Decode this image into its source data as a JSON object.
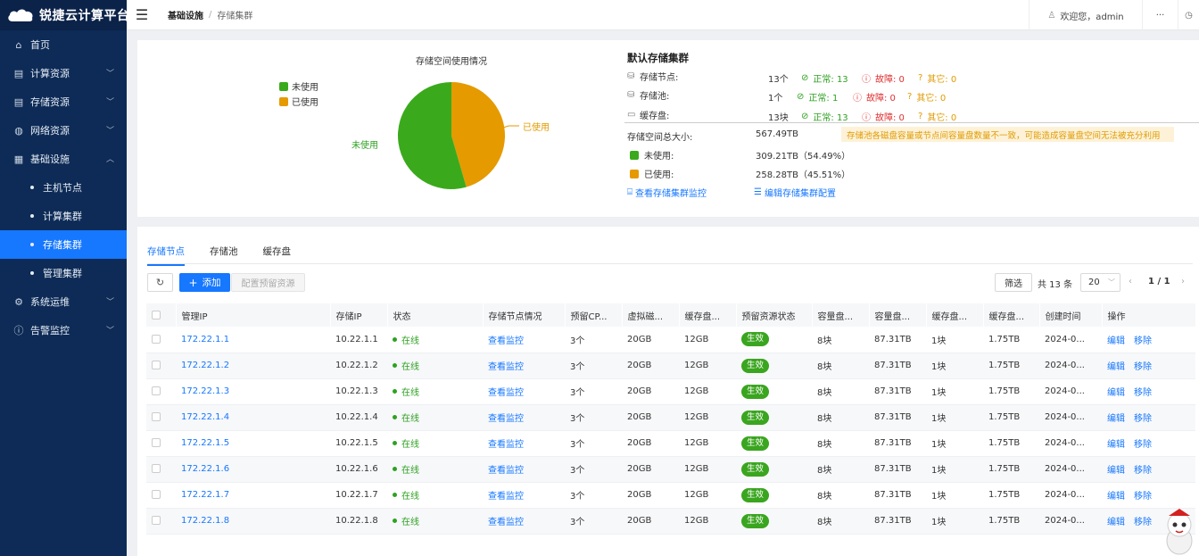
{
  "app": {
    "title": "锐捷云计算平台"
  },
  "sidebar": {
    "items": [
      {
        "label": "首页",
        "icon": "home-icon"
      },
      {
        "label": "计算资源",
        "icon": "server-icon"
      },
      {
        "label": "存储资源",
        "icon": "storage-icon"
      },
      {
        "label": "网络资源",
        "icon": "globe-icon"
      },
      {
        "label": "基础设施",
        "icon": "grid-icon"
      },
      {
        "label": "主机节点"
      },
      {
        "label": "计算集群"
      },
      {
        "label": "存储集群"
      },
      {
        "label": "管理集群"
      },
      {
        "label": "系统运维",
        "icon": "gear-icon"
      },
      {
        "label": "告警监控",
        "icon": "alert-icon"
      }
    ],
    "active": "存储集群"
  },
  "header": {
    "breadcrumb": [
      "基础设施",
      "存储集群"
    ],
    "separator": "/",
    "welcome": "欢迎您，admin",
    "more": "···"
  },
  "usage": {
    "title": "存储空间使用情况",
    "legend": [
      "未使用",
      "已使用"
    ],
    "label_unused": "未使用",
    "label_used": "已使用",
    "colors": {
      "unused": "#3aaa1c",
      "used": "#e59a00"
    }
  },
  "chart_data": {
    "type": "pie",
    "title": "存储空间使用情况",
    "categories": [
      "未使用",
      "已使用"
    ],
    "values": [
      54.49,
      45.51
    ],
    "units": "%",
    "legend_position": "top-left"
  },
  "cluster": {
    "title": "默认存储集群",
    "rows": [
      {
        "label": "存储节点:",
        "count": "13个",
        "normal": "正常: 13",
        "fault": "故障: 0",
        "other": "其它: 0"
      },
      {
        "label": "存储池:",
        "count": "1个",
        "normal": "正常: 1",
        "fault": "故障: 0",
        "other": "其它: 0"
      },
      {
        "label": "缓存盘:",
        "count": "13块",
        "normal": "正常: 13",
        "fault": "故障: 0",
        "other": "其它: 0"
      }
    ],
    "total_label": "存储空间总大小:",
    "total_value": "567.49TB",
    "warning": "存储池各磁盘容量或节点间容量盘数量不一致，可能造成容量盘空间无法被充分利用",
    "unused_label": "未使用:",
    "unused_value": "309.21TB（54.49%）",
    "used_label": "已使用:",
    "used_value": "258.28TB（45.51%）",
    "link_monitor": "查看存储集群监控",
    "link_config": "编辑存储集群配置"
  },
  "tabs": [
    "存储节点",
    "存储池",
    "缓存盘"
  ],
  "toolbar": {
    "refresh": "↻",
    "add": "添加",
    "reserve": "配置预留资源"
  },
  "pagination": {
    "filter": "筛选",
    "total": "共 13 条",
    "page_size": "20",
    "page": "1 / 1",
    "prev": "‹",
    "next": "›"
  },
  "table": {
    "columns": [
      "管理IP",
      "存储IP",
      "状态",
      "存储节点情况",
      "预留CP...",
      "虚拟磁...",
      "缓存盘...",
      "预留资源状态",
      "容量盘...",
      "容量盘...",
      "缓存盘...",
      "缓存盘...",
      "创建时间",
      "操作"
    ],
    "rows": [
      {
        "mgmt_ip": "172.22.1.1",
        "storage_ip": "10.22.1.1",
        "status": "在线",
        "monitor": "查看监控",
        "cpu": "3个",
        "vdisk": "20GB",
        "cache": "12GB",
        "res_status": "生效",
        "cap_count": "8块",
        "cap_size": "87.31TB",
        "cache_count": "1块",
        "cache_size": "1.75TB",
        "created": "2024-0...",
        "edit": "编辑",
        "remove": "移除"
      },
      {
        "mgmt_ip": "172.22.1.2",
        "storage_ip": "10.22.1.2",
        "status": "在线",
        "monitor": "查看监控",
        "cpu": "3个",
        "vdisk": "20GB",
        "cache": "12GB",
        "res_status": "生效",
        "cap_count": "8块",
        "cap_size": "87.31TB",
        "cache_count": "1块",
        "cache_size": "1.75TB",
        "created": "2024-0...",
        "edit": "编辑",
        "remove": "移除"
      },
      {
        "mgmt_ip": "172.22.1.3",
        "storage_ip": "10.22.1.3",
        "status": "在线",
        "monitor": "查看监控",
        "cpu": "3个",
        "vdisk": "20GB",
        "cache": "12GB",
        "res_status": "生效",
        "cap_count": "8块",
        "cap_size": "87.31TB",
        "cache_count": "1块",
        "cache_size": "1.75TB",
        "created": "2024-0...",
        "edit": "编辑",
        "remove": "移除"
      },
      {
        "mgmt_ip": "172.22.1.4",
        "storage_ip": "10.22.1.4",
        "status": "在线",
        "monitor": "查看监控",
        "cpu": "3个",
        "vdisk": "20GB",
        "cache": "12GB",
        "res_status": "生效",
        "cap_count": "8块",
        "cap_size": "87.31TB",
        "cache_count": "1块",
        "cache_size": "1.75TB",
        "created": "2024-0...",
        "edit": "编辑",
        "remove": "移除"
      },
      {
        "mgmt_ip": "172.22.1.5",
        "storage_ip": "10.22.1.5",
        "status": "在线",
        "monitor": "查看监控",
        "cpu": "3个",
        "vdisk": "20GB",
        "cache": "12GB",
        "res_status": "生效",
        "cap_count": "8块",
        "cap_size": "87.31TB",
        "cache_count": "1块",
        "cache_size": "1.75TB",
        "created": "2024-0...",
        "edit": "编辑",
        "remove": "移除"
      },
      {
        "mgmt_ip": "172.22.1.6",
        "storage_ip": "10.22.1.6",
        "status": "在线",
        "monitor": "查看监控",
        "cpu": "3个",
        "vdisk": "20GB",
        "cache": "12GB",
        "res_status": "生效",
        "cap_count": "8块",
        "cap_size": "87.31TB",
        "cache_count": "1块",
        "cache_size": "1.75TB",
        "created": "2024-0...",
        "edit": "编辑",
        "remove": "移除"
      },
      {
        "mgmt_ip": "172.22.1.7",
        "storage_ip": "10.22.1.7",
        "status": "在线",
        "monitor": "查看监控",
        "cpu": "3个",
        "vdisk": "20GB",
        "cache": "12GB",
        "res_status": "生效",
        "cap_count": "8块",
        "cap_size": "87.31TB",
        "cache_count": "1块",
        "cache_size": "1.75TB",
        "created": "2024-0...",
        "edit": "编辑",
        "remove": "移除"
      },
      {
        "mgmt_ip": "172.22.1.8",
        "storage_ip": "10.22.1.8",
        "status": "在线",
        "monitor": "查看监控",
        "cpu": "3个",
        "vdisk": "20GB",
        "cache": "12GB",
        "res_status": "生效",
        "cap_count": "8块",
        "cap_size": "87.31TB",
        "cache_count": "1块",
        "cache_size": "1.75TB",
        "created": "2024-0...",
        "edit": "编辑",
        "remove": "移除"
      }
    ]
  }
}
